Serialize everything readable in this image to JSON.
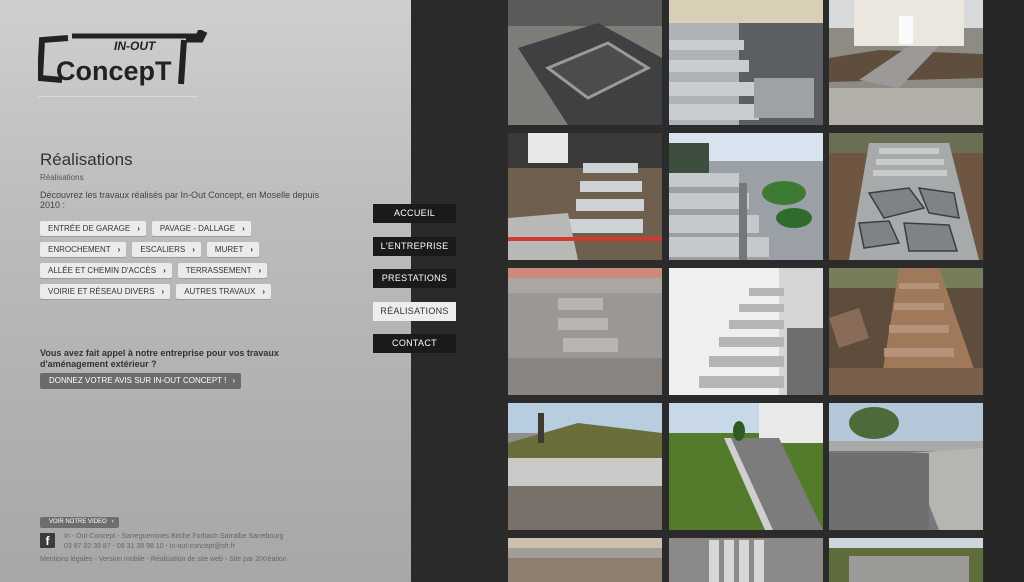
{
  "logo": {
    "top": "IN-OUT",
    "main": "ConcepT"
  },
  "page": {
    "title": "Réalisations",
    "breadcrumb": "Réalisations",
    "intro": "Découvrez les travaux réalisés par In-Out Concept, en Moselle depuis 2010 :"
  },
  "categories": {
    "row1": [
      "ENTRÉE DE GARAGE",
      "PAVAGE - DALLAGE"
    ],
    "row2": [
      "ENROCHEMENT",
      "ESCALIERS",
      "MURET"
    ],
    "row3": [
      "ALLÉE ET CHEMIN D'ACCÈS",
      "TERRASSEMENT"
    ],
    "row4": [
      "VOIRIE ET RÉSEAU DIVERS",
      "AUTRES TRAVAUX"
    ]
  },
  "review": {
    "question": "Vous avez fait appel à notre entreprise pour vos travaux d'aménagement extérieur ?",
    "button": "DONNEZ VOTRE AVIS SUR IN-OUT CONCEPT !"
  },
  "footer": {
    "video": "VOIR NOTRE VIDEO",
    "line1": "In - Out Concept - Sarreguemines Bitche Forbach Sarralbe Sarrebourg",
    "line2": "03 87 02 39 87 - 06 31 38 98 10 - in-out-concept@sfr.fr",
    "line3": "Mentions légales - Version mobile - Réalisation de site web - Site par 2iXréation",
    "facebook": "f"
  },
  "nav": [
    "ACCUEIL",
    "L'ENTREPRISE",
    "PRESTATIONS",
    "RÉALISATIONS",
    "CONTACT"
  ],
  "nav_active_index": 3,
  "colors": {
    "nav_bg": "#1a1a1a",
    "nav_active_bg": "#ededed",
    "panel_bg": "#c2c2c2",
    "dark_bg": "#2b2b2b"
  }
}
